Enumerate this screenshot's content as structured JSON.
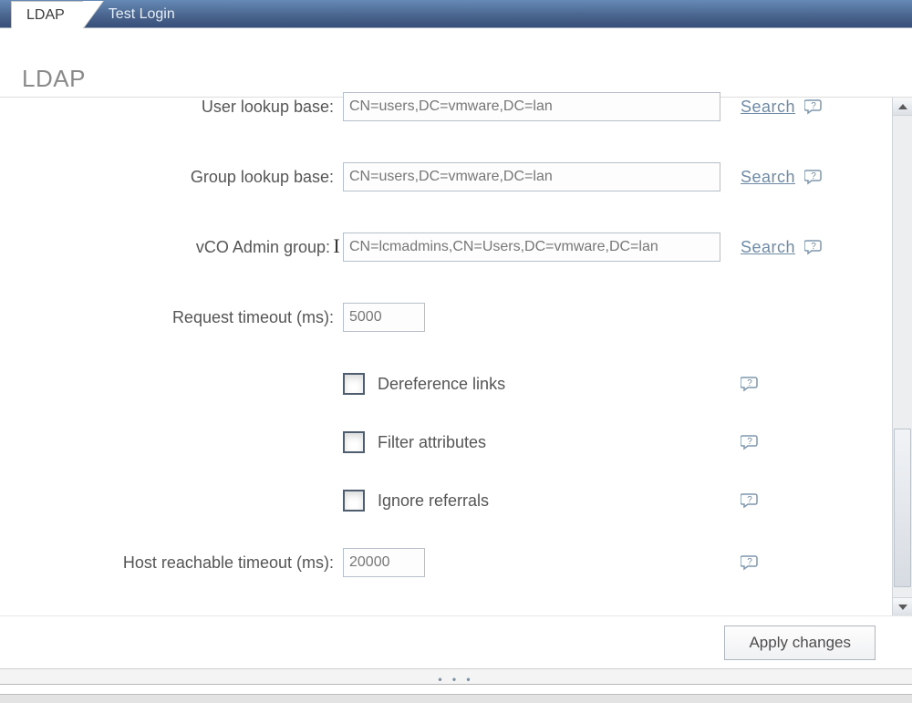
{
  "tabs": {
    "ldap": "LDAP",
    "test_login": "Test Login"
  },
  "section_title": "LDAP",
  "form": {
    "user_lookup_base": {
      "label": "User lookup base:",
      "value": "CN=users,DC=vmware,DC=lan"
    },
    "group_lookup_base": {
      "label": "Group lookup base:",
      "value": "CN=users,DC=vmware,DC=lan"
    },
    "vco_admin_group": {
      "label": "vCO Admin group:",
      "value": "CN=lcmadmins,CN=Users,DC=vmware,DC=lan"
    },
    "request_timeout": {
      "label": "Request timeout (ms):",
      "value": "5000"
    },
    "dereference_links": {
      "label": "Dereference links",
      "checked": false
    },
    "filter_attributes": {
      "label": "Filter attributes",
      "checked": false
    },
    "ignore_referrals": {
      "label": "Ignore referrals",
      "checked": false
    },
    "host_reachable_timeout": {
      "label": "Host reachable timeout (ms):",
      "value": "20000"
    }
  },
  "actions": {
    "search": "Search",
    "apply": "Apply changes"
  }
}
